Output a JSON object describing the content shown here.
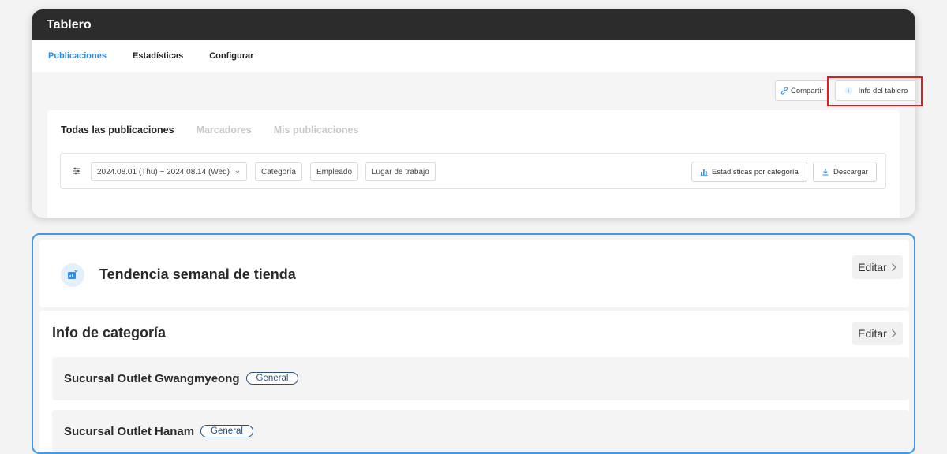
{
  "window": {
    "title": "Tablero"
  },
  "nav": {
    "items": [
      {
        "label": "Publicaciones",
        "active": true
      },
      {
        "label": "Estadísticas",
        "active": false
      },
      {
        "label": "Configurar",
        "active": false
      }
    ]
  },
  "actions": {
    "share_label": "Compartir",
    "info_label": "Info del tablero"
  },
  "post_tabs": [
    {
      "label": "Todas las publicaciones",
      "active": true
    },
    {
      "label": "Marcadores",
      "active": false
    },
    {
      "label": "Mis publicaciones",
      "active": false
    }
  ],
  "filters": {
    "date_range": "2024.08.01 (Thu) ~ 2024.08.14 (Wed)",
    "chips": [
      "Categoría",
      "Empleado",
      "Lugar de trabajo"
    ],
    "stats_label": "Estadísticas por categoría",
    "download_label": "Descargar"
  },
  "trend_card": {
    "title": "Tendencia semanal de tienda",
    "edit_label": "Editar"
  },
  "category_card": {
    "title": "Info de categoría",
    "edit_label": "Editar",
    "branches": [
      {
        "name": "Sucursal Outlet Gwangmyeong",
        "badge": "General"
      },
      {
        "name": "Sucursal Outlet Hanam",
        "badge": "General"
      }
    ]
  },
  "colors": {
    "accent": "#2a8ee8",
    "highlight": "#e11d1d",
    "titlebar": "#2c2c2c"
  }
}
